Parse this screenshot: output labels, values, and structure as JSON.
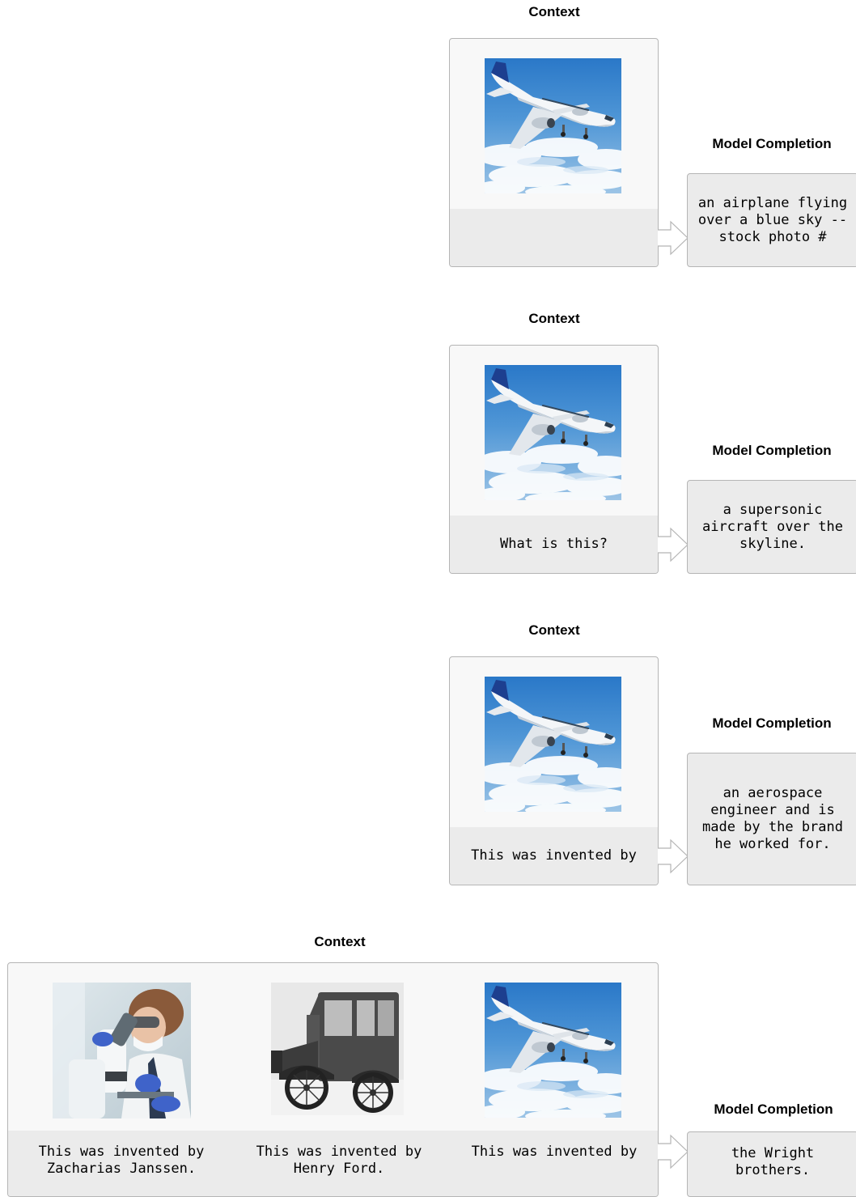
{
  "panels": [
    {
      "context_heading": "Context",
      "context_texts": [
        ""
      ],
      "completion_heading": "Model Completion",
      "completion": "an airplane flying over a blue sky -- stock photo #"
    },
    {
      "context_heading": "Context",
      "context_texts": [
        "What is this?"
      ],
      "completion_heading": "Model Completion",
      "completion": "a supersonic aircraft over the skyline."
    },
    {
      "context_heading": "Context",
      "context_texts": [
        "This was invented by"
      ],
      "completion_heading": "Model Completion",
      "completion": "an aerospace engineer and is made by the brand he worked for."
    },
    {
      "context_heading": "Context",
      "context_texts": [
        "This was invented by Zacharias Janssen.",
        "This was invented by Henry Ford.",
        "This was invented by"
      ],
      "completion_heading": "Model Completion",
      "completion": "the Wright brothers."
    }
  ],
  "images": {
    "airplane": "airplane-photo",
    "scientist": "scientist-microscope-photo",
    "car": "vintage-car-photo"
  },
  "colors": {
    "box_border": "#b5b5b5",
    "box_fill": "#f8f8f8",
    "text_fill": "#ebebeb"
  }
}
